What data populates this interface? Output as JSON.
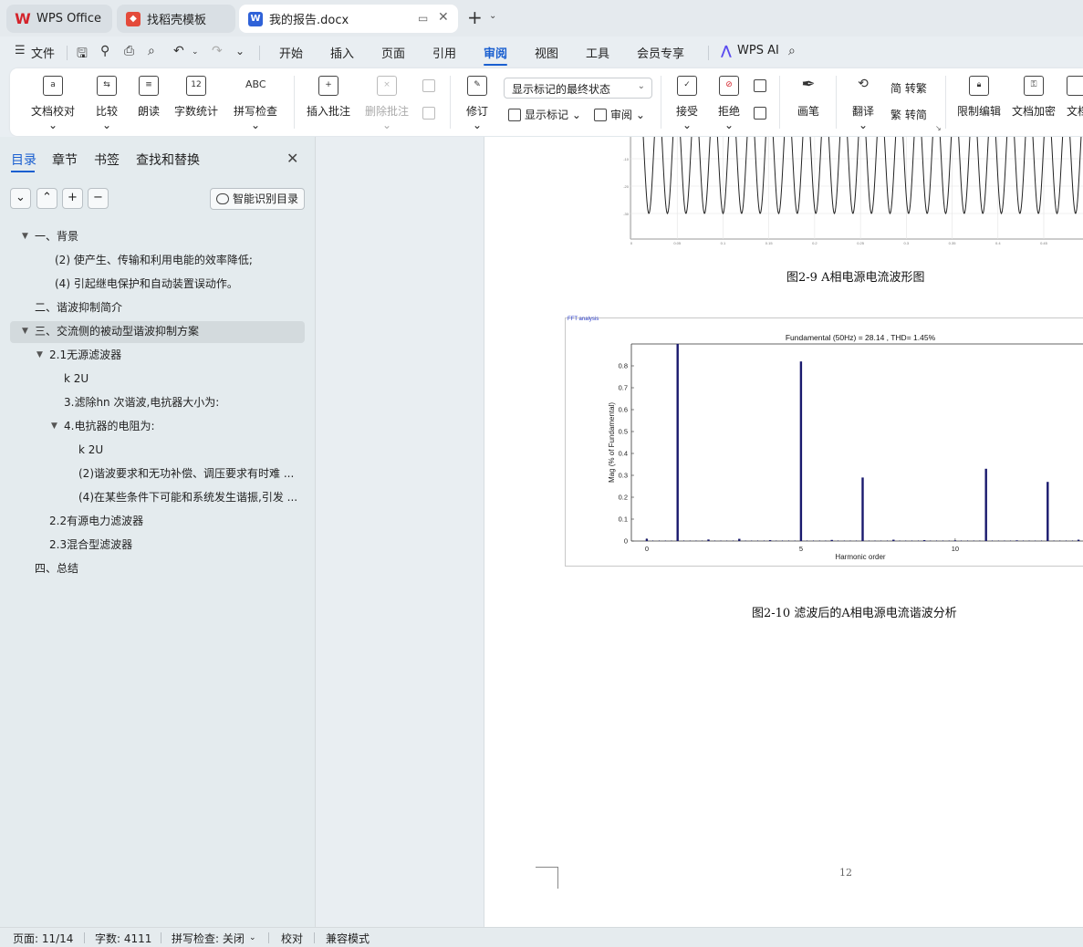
{
  "tabs": [
    {
      "label": "WPS Office",
      "icon": "wps-logo-icon",
      "color": "#d4232b"
    },
    {
      "label": "找稻壳模板",
      "icon": "docer-logo-icon",
      "color": "#e44a3a"
    },
    {
      "label": "我的报告.docx",
      "icon": "word-doc-icon",
      "color": "#2f62d8"
    }
  ],
  "menu": {
    "file": "文件",
    "items": [
      "开始",
      "插入",
      "页面",
      "引用",
      "审阅",
      "视图",
      "工具",
      "会员专享"
    ],
    "active": "审阅",
    "wps_ai": "WPS AI"
  },
  "ribbon": {
    "doc_check": "文档校对",
    "compare": "比较",
    "read_aloud": "朗读",
    "word_count": "字数统计",
    "spell_check": "拼写检查",
    "insert_comment": "插入批注",
    "delete_comment": "删除批注",
    "track_changes": "修订",
    "markup_state": "显示标记的最终状态",
    "show_markup": "显示标记",
    "review_pane": "审阅",
    "accept": "接受",
    "reject": "拒绝",
    "ink": "画笔",
    "translate": "翻译",
    "to_traditional": "转繁",
    "to_simplified": "转简",
    "restrict_edit": "限制编辑",
    "encrypt": "文档加密",
    "more_cut": "文档",
    "icon_texts": {
      "word_count": "12",
      "spell": "ABC",
      "simp_glyph": "简",
      "trad_glyph": "繁"
    }
  },
  "sidebar": {
    "tabs": [
      "目录",
      "章节",
      "书签",
      "查找和替换"
    ],
    "smart_toc": "智能识别目录",
    "toc": [
      {
        "text": "一、背景",
        "level": 1,
        "arrow": true
      },
      {
        "text": "(2) 使产生、传输和利用电能的效率降低;",
        "level": 2
      },
      {
        "text": "(4) 引起继电保护和自动装置误动作。",
        "level": 2
      },
      {
        "text": "二、谐波抑制简介",
        "level": 1
      },
      {
        "text": "三、交流侧的被动型谐波抑制方案",
        "level": 1,
        "arrow": true,
        "selected": true
      },
      {
        "text": "2.1无源滤波器",
        "level": 2,
        "arrow": true
      },
      {
        "text": "k 2U",
        "level": 3
      },
      {
        "text": "3.滤除hn 次谐波,电抗器大小为:",
        "level": 3
      },
      {
        "text": "4.电抗器的电阻为:",
        "level": 3,
        "arrow": true
      },
      {
        "text": "k 2U",
        "level": 4
      },
      {
        "text": "(2)谐波要求和无功补偿、调压要求有时难 ...",
        "level": 4
      },
      {
        "text": "(4)在某些条件下可能和系统发生谐振,引发 ...",
        "level": 4
      },
      {
        "text": "2.2有源电力滤波器",
        "level": 2
      },
      {
        "text": "2.3混合型滤波器",
        "level": 2
      },
      {
        "text": "四、总结",
        "level": 1
      }
    ]
  },
  "document": {
    "caption1": "图2-9 A相电源电流波形图",
    "caption2": "图2-10 滤波后的A相电源电流谐波分析",
    "page_number": "12",
    "waveform": {
      "y_ticks": [
        "-10",
        "-20",
        "-30"
      ],
      "x_ticks": [
        "0",
        "0.05",
        "0.1",
        "0.15",
        "0.2",
        "0.25",
        "0.3",
        "0.35",
        "0.4",
        "0.45"
      ],
      "cycles": 24
    }
  },
  "chart_data": {
    "type": "bar",
    "panel_label": "FFT analysis",
    "title": "Fundamental (50Hz) = 28.14 , THD= 1.45%",
    "xlabel": "Harmonic order",
    "ylabel": "Mag (% of Fundamental)",
    "x_ticks": [
      0,
      5,
      10
    ],
    "y_ticks": [
      "0",
      "0.1",
      "0.2",
      "0.3",
      "0.4",
      "0.5",
      "0.6",
      "0.7",
      "0.8"
    ],
    "xlim": [
      -0.5,
      14.5
    ],
    "ylim": [
      0,
      0.9
    ],
    "bar_color": "#1a1a6e",
    "x": [
      0,
      1,
      2,
      3,
      4,
      5,
      6,
      7,
      8,
      9,
      10,
      11,
      12,
      13,
      14
    ],
    "values": [
      0.01,
      0.9,
      0.007,
      0.01,
      0.004,
      0.82,
      0.005,
      0.29,
      0.006,
      0.004,
      0.003,
      0.33,
      0.003,
      0.27,
      0.006
    ],
    "minor_values": [
      0.003,
      0.003,
      0.003,
      0.003,
      0.003,
      0.003,
      0.003,
      0.003,
      0.003,
      0.003,
      0.003,
      0.003,
      0.003,
      0.003
    ]
  },
  "status": {
    "page": "页面: 11/14",
    "words": "字数: 4111",
    "spell": "拼写检查: 关闭",
    "proof": "校对",
    "compat": "兼容模式"
  }
}
